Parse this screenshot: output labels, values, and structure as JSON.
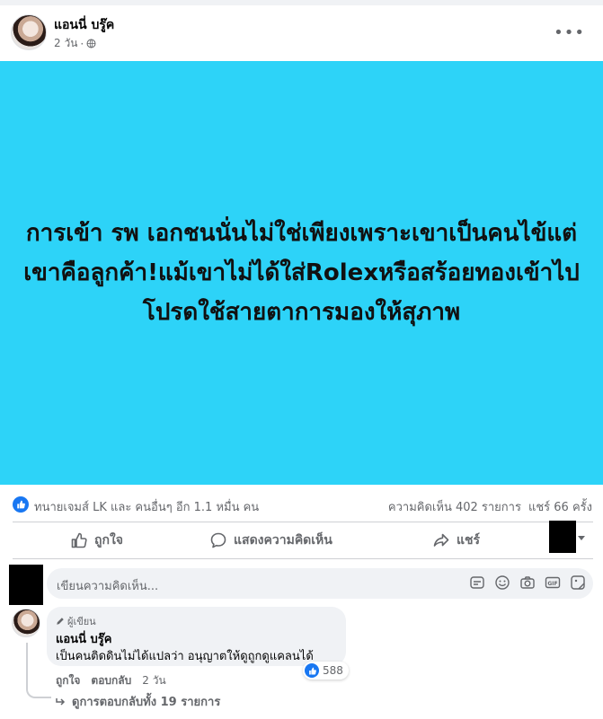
{
  "post": {
    "author": "แอนนี่ บรู๊ค",
    "time": "2 วัน",
    "separator": "·",
    "more_label": "•••",
    "image_text": "การเข้า รพ เอกชนนั่นไม่ใช่เพียงเพราะเขาเป็นคนไข้แต่เขาคือลูกค้า!แม้เขาไม่ได้ใส่Rolexหรือสร้อยทองเข้าไปโปรดใช้สายตาการมองให้สุภาพ",
    "image_bg_color": "#2dd3f8"
  },
  "stats": {
    "reactions_text": "ทนายเจมส์ LK และ คนอื่นๆ อีก 1.1 หมื่น คน",
    "comments": "ความคิดเห็น 402 รายการ",
    "shares": "แชร์ 66 ครั้ง"
  },
  "actions": {
    "like": "ถูกใจ",
    "comment": "แสดงความคิดเห็น",
    "share": "แชร์"
  },
  "comment_input": {
    "placeholder": "เขียนความคิดเห็น...",
    "icons": [
      "sticker-icon",
      "emoji-icon",
      "camera-icon",
      "gif-icon",
      "image-sticker-icon"
    ],
    "gif_label": "GIF"
  },
  "comment": {
    "author_tag": "ผู้เขียน",
    "author": "แอนนี่ บรู๊ค",
    "text": "เป็นคนติดดินไม่ได้แปลว่า อนุญาตให้ดูถูกดูแคลนได้",
    "reaction_count": "588",
    "like": "ถูกใจ",
    "reply": "ตอบกลับ",
    "time": "2 วัน",
    "view_replies": "ดูการตอบกลับทั้ง 19 รายการ"
  },
  "colors": {
    "accent": "#1877f2",
    "muted_text": "#65676b",
    "bubble_bg": "#f0f2f5"
  }
}
